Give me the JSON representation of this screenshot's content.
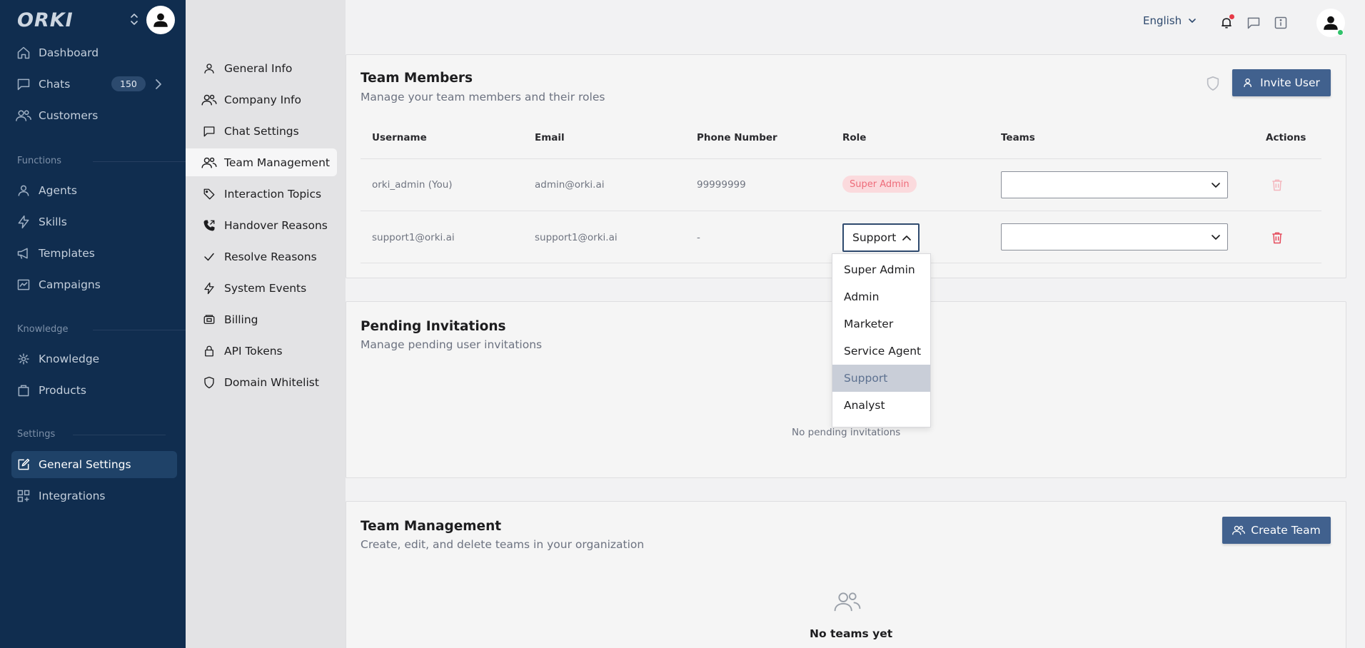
{
  "brand": {
    "name": "ORKI"
  },
  "sidebar": {
    "items": [
      {
        "label": "Dashboard",
        "icon": "home-icon"
      },
      {
        "label": "Chats",
        "icon": "chat-icon",
        "badge": "150"
      },
      {
        "label": "Customers",
        "icon": "users-icon"
      }
    ],
    "sections": [
      {
        "label": "Functions",
        "items": [
          {
            "label": "Agents",
            "icon": "agents-icon"
          },
          {
            "label": "Skills",
            "icon": "bolt-icon"
          },
          {
            "label": "Templates",
            "icon": "megaphone-icon"
          },
          {
            "label": "Campaigns",
            "icon": "campaign-icon"
          }
        ]
      },
      {
        "label": "Knowledge",
        "items": [
          {
            "label": "Knowledge",
            "icon": "brain-icon"
          },
          {
            "label": "Products",
            "icon": "bag-icon"
          }
        ]
      },
      {
        "label": "Settings",
        "items": [
          {
            "label": "General Settings",
            "icon": "edit-icon",
            "active": true
          },
          {
            "label": "Integrations",
            "icon": "grid-plus-icon"
          }
        ]
      }
    ]
  },
  "submenu": {
    "items": [
      "General Info",
      "Company Info",
      "Chat Settings",
      "Team Management",
      "Interaction Topics",
      "Handover Reasons",
      "Resolve Reasons",
      "System Events",
      "Billing",
      "API Tokens",
      "Domain Whitelist"
    ],
    "active": "Team Management"
  },
  "topbar": {
    "language": "English"
  },
  "team_members": {
    "title": "Team Members",
    "subtitle": "Manage your team members and their roles",
    "invite_label": "Invite User",
    "columns": [
      "Username",
      "Email",
      "Phone Number",
      "Role",
      "Teams",
      "Actions"
    ],
    "rows": [
      {
        "username": "orki_admin (You)",
        "email": "admin@orki.ai",
        "phone": "99999999",
        "role": "Super Admin"
      },
      {
        "username": "support1@orki.ai",
        "email": "support1@orki.ai",
        "phone": "-",
        "role": "Support"
      }
    ]
  },
  "role_dropdown": {
    "options": [
      "Super Admin",
      "Admin",
      "Marketer",
      "Service Agent",
      "Support",
      "Analyst"
    ],
    "selected": "Support"
  },
  "pending": {
    "title": "Pending Invitations",
    "subtitle": "Manage pending user invitations",
    "empty": "No pending invitations"
  },
  "teams": {
    "title": "Team Management",
    "subtitle": "Create, edit, and delete teams in your organization",
    "create_label": "Create Team",
    "empty": "No teams yet"
  },
  "colors": {
    "sidebar_bg": "#102d4f",
    "primary_button": "#41618e",
    "danger": "#ee6c7a"
  }
}
